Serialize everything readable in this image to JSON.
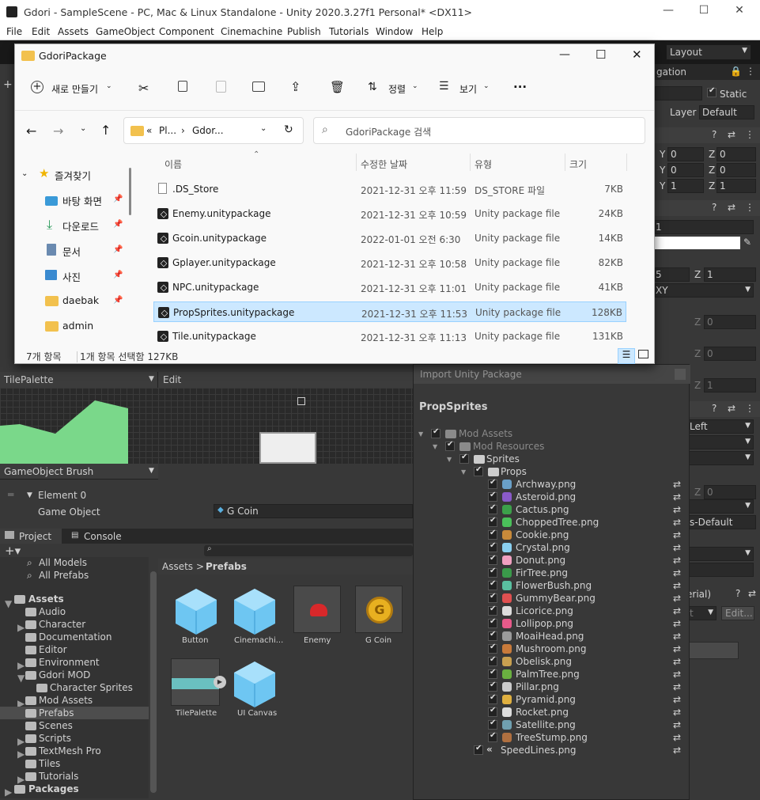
{
  "unity": {
    "title": "Gdori - SampleScene - PC, Mac & Linux Standalone - Unity 2020.3.27f1 Personal* <DX11>",
    "menu": [
      "File",
      "Edit",
      "Assets",
      "GameObject",
      "Component",
      "Cinemachine",
      "Publish",
      "Tutorials",
      "Window",
      "Help"
    ],
    "layout_label": "Layout"
  },
  "explorer": {
    "title": "GdoriPackage",
    "new_label": "새로 만들기",
    "sort_label": "정렬",
    "view_label": "보기",
    "more": "···",
    "path1": "Pl...",
    "path2": "Gdor...",
    "path_prefix": "«",
    "search_placeholder": "GdoriPackage 검색",
    "columns": {
      "name": "이름",
      "date": "수정한 날짜",
      "type": "유형",
      "size": "크기"
    },
    "nav": [
      {
        "label": "즐겨찾기"
      },
      {
        "label": "바탕 화면"
      },
      {
        "label": "다운로드"
      },
      {
        "label": "문서"
      },
      {
        "label": "사진"
      },
      {
        "label": "daebak"
      },
      {
        "label": "admin"
      }
    ],
    "files": [
      {
        "name": ".DS_Store",
        "date": "2021-12-31 오후 11:59",
        "type": "DS_STORE 파일",
        "size": "7KB"
      },
      {
        "name": "Enemy.unitypackage",
        "date": "2021-12-31 오후 10:59",
        "type": "Unity package file",
        "size": "24KB"
      },
      {
        "name": "Gcoin.unitypackage",
        "date": "2022-01-01 오전 6:30",
        "type": "Unity package file",
        "size": "14KB"
      },
      {
        "name": "Gplayer.unitypackage",
        "date": "2021-12-31 오후 10:58",
        "type": "Unity package file",
        "size": "82KB"
      },
      {
        "name": "NPC.unitypackage",
        "date": "2021-12-31 오후 11:01",
        "type": "Unity package file",
        "size": "41KB"
      },
      {
        "name": "PropSprites.unitypackage",
        "date": "2021-12-31 오후 11:53",
        "type": "Unity package file",
        "size": "128KB"
      },
      {
        "name": "Tile.unitypackage",
        "date": "2021-12-31 오후 11:13",
        "type": "Unity package file",
        "size": "131KB"
      }
    ],
    "status_count": "7개 항목",
    "status_selected": "1개 항목 선택함 127KB"
  },
  "inspector": {
    "navigation": "gation",
    "static_label": "Static",
    "layer_label": "Layer",
    "layer_value": "Default",
    "y": "Y",
    "z": "Z",
    "pos_y": "0",
    "pos_z": "0",
    "rot_y": "0",
    "rot_z": "0",
    "scl_y": "1",
    "scl_z": "1",
    "val_1": "1",
    "val_5": "5",
    "z1": "1",
    "xy": "XY",
    "z0a": "0",
    "z0b": "0",
    "z1b": "1",
    "left": "Left",
    "z0c": "0",
    "sdefault": "s-Default",
    "erial": "erial)",
    "t": "t",
    "edit": "Edit..."
  },
  "tilepalette": {
    "title": "TilePalette",
    "edit": "Edit",
    "brush": "GameObject Brush",
    "element": "Element 0",
    "go_label": "Game Object",
    "go_value": "G Coin"
  },
  "project": {
    "tab_project": "Project",
    "tab_console": "Console",
    "breadcrumb_assets": "Assets",
    "breadcrumb_sep": ">",
    "breadcrumb_prefabs": "Prefabs",
    "tree": [
      {
        "label": "All Models",
        "indent": 2
      },
      {
        "label": "All Prefabs",
        "indent": 2
      },
      {
        "label": "Assets",
        "indent": 0,
        "bold": true
      },
      {
        "label": "Audio",
        "indent": 1
      },
      {
        "label": "Character",
        "indent": 1
      },
      {
        "label": "Documentation",
        "indent": 1
      },
      {
        "label": "Editor",
        "indent": 1
      },
      {
        "label": "Environment",
        "indent": 1
      },
      {
        "label": "Gdori MOD",
        "indent": 1
      },
      {
        "label": "Character Sprites",
        "indent": 2
      },
      {
        "label": "Mod Assets",
        "indent": 1
      },
      {
        "label": "Prefabs",
        "indent": 1
      },
      {
        "label": "Scenes",
        "indent": 1
      },
      {
        "label": "Scripts",
        "indent": 1
      },
      {
        "label": "TextMesh Pro",
        "indent": 1
      },
      {
        "label": "Tiles",
        "indent": 1
      },
      {
        "label": "Tutorials",
        "indent": 1
      },
      {
        "label": "Packages",
        "indent": 0,
        "bold": true
      }
    ],
    "assets": [
      {
        "label": "Button"
      },
      {
        "label": "Cinemachi..."
      },
      {
        "label": "Enemy"
      },
      {
        "label": "G Coin"
      },
      {
        "label": "TilePalette"
      },
      {
        "label": "UI Canvas"
      }
    ]
  },
  "import": {
    "title": "Import Unity Package",
    "package": "PropSprites",
    "folders": [
      "Mod Assets",
      "Mod Resources",
      "Sprites",
      "Props"
    ],
    "files": [
      {
        "name": "Archway.png",
        "color": "#6aa0c8"
      },
      {
        "name": "Asteroid.png",
        "color": "#8a5ac8"
      },
      {
        "name": "Cactus.png",
        "color": "#3ca04a"
      },
      {
        "name": "ChoppedTree.png",
        "color": "#4ac05a"
      },
      {
        "name": "Cookie.png",
        "color": "#c88a3a"
      },
      {
        "name": "Crystal.png",
        "color": "#8ad0f0"
      },
      {
        "name": "Donut.png",
        "color": "#f0a0c0"
      },
      {
        "name": "FirTree.png",
        "color": "#3a9a4a"
      },
      {
        "name": "FlowerBush.png",
        "color": "#5ac0a0"
      },
      {
        "name": "GummyBear.png",
        "color": "#e05050"
      },
      {
        "name": "Licorice.png",
        "color": "#dddddd"
      },
      {
        "name": "Lollipop.png",
        "color": "#e85a8a"
      },
      {
        "name": "MoaiHead.png",
        "color": "#9a9a9a"
      },
      {
        "name": "Mushroom.png",
        "color": "#c87a3a"
      },
      {
        "name": "Obelisk.png",
        "color": "#c8a050"
      },
      {
        "name": "PalmTree.png",
        "color": "#6ab040"
      },
      {
        "name": "Pillar.png",
        "color": "#cccccc"
      },
      {
        "name": "Pyramid.png",
        "color": "#e0b040"
      },
      {
        "name": "Rocket.png",
        "color": "#dddddd"
      },
      {
        "name": "Satellite.png",
        "color": "#70a0b0"
      },
      {
        "name": "TreeStump.png",
        "color": "#b07040"
      }
    ],
    "extra": "SpeedLines.png"
  }
}
